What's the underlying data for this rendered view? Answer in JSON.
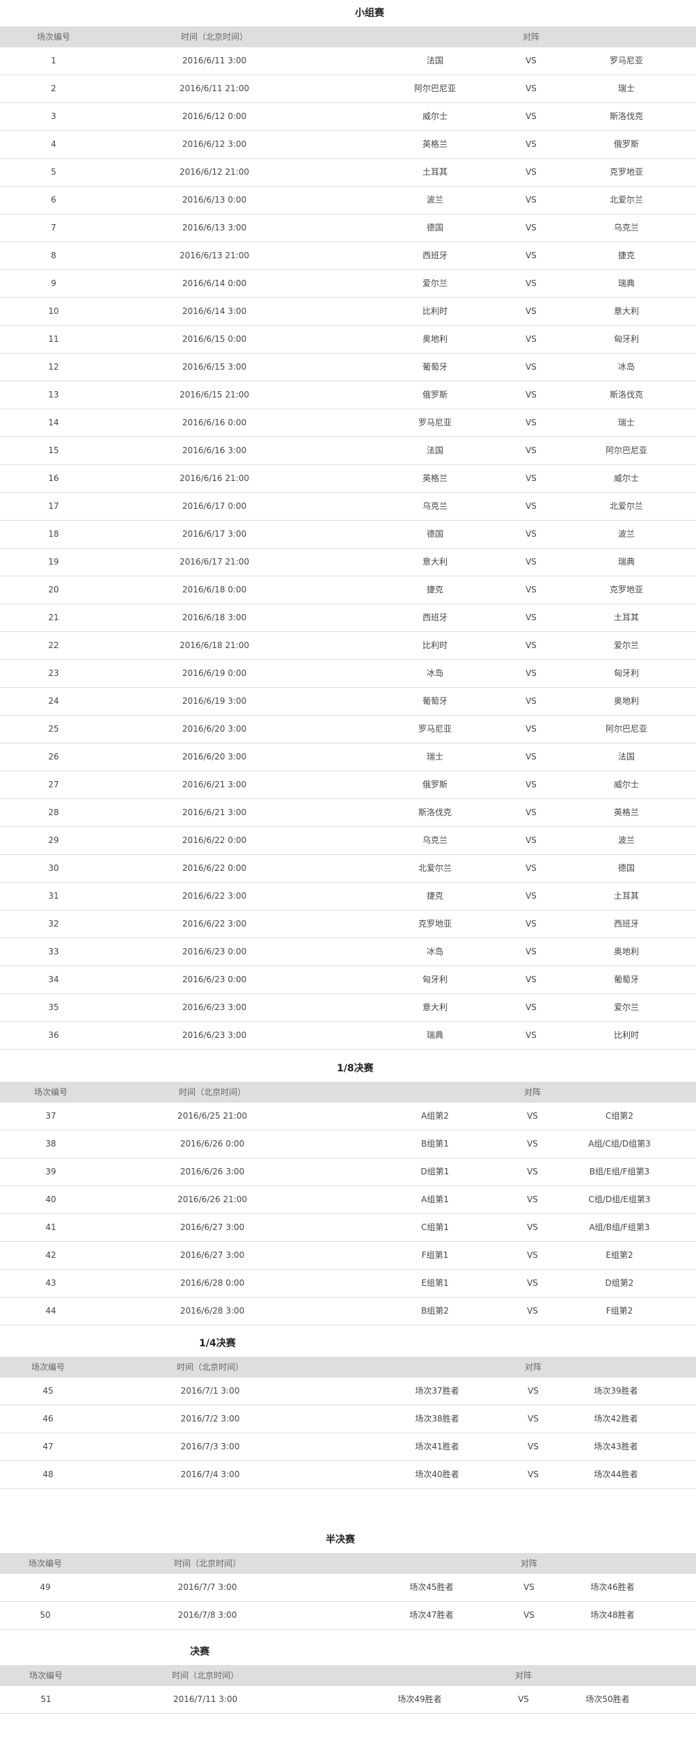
{
  "headers": {
    "num": "场次编号",
    "time": "时间（北京时间）",
    "match": "对阵",
    "vs": "VS"
  },
  "sections": [
    {
      "key": "group",
      "title": "小组赛",
      "rows": [
        [
          "1",
          "2016/6/11 3:00",
          "法国",
          "罗马尼亚"
        ],
        [
          "2",
          "2016/6/11 21:00",
          "阿尔巴尼亚",
          "瑞士"
        ],
        [
          "3",
          "2016/6/12 0:00",
          "威尔士",
          "斯洛伐克"
        ],
        [
          "4",
          "2016/6/12 3:00",
          "英格兰",
          "俄罗斯"
        ],
        [
          "5",
          "2016/6/12 21:00",
          "土耳其",
          "克罗地亚"
        ],
        [
          "6",
          "2016/6/13 0:00",
          "波兰",
          "北爱尔兰"
        ],
        [
          "7",
          "2016/6/13 3:00",
          "德国",
          "乌克兰"
        ],
        [
          "8",
          "2016/6/13 21:00",
          "西班牙",
          "捷克"
        ],
        [
          "9",
          "2016/6/14 0:00",
          "爱尔兰",
          "瑞典"
        ],
        [
          "10",
          "2016/6/14 3:00",
          "比利时",
          "意大利"
        ],
        [
          "11",
          "2016/6/15 0:00",
          "奥地利",
          "匈牙利"
        ],
        [
          "12",
          "2016/6/15 3:00",
          "葡萄牙",
          "冰岛"
        ],
        [
          "13",
          "2016/6/15 21:00",
          "俄罗斯",
          "斯洛伐克"
        ],
        [
          "14",
          "2016/6/16 0:00",
          "罗马尼亚",
          "瑞士"
        ],
        [
          "15",
          "2016/6/16 3:00",
          "法国",
          "阿尔巴尼亚"
        ],
        [
          "16",
          "2016/6/16 21:00",
          "英格兰",
          "威尔士"
        ],
        [
          "17",
          "2016/6/17 0:00",
          "乌克兰",
          "北爱尔兰"
        ],
        [
          "18",
          "2016/6/17 3:00",
          "德国",
          "波兰"
        ],
        [
          "19",
          "2016/6/17 21:00",
          "意大利",
          "瑞典"
        ],
        [
          "20",
          "2016/6/18 0:00",
          "捷克",
          "克罗地亚"
        ],
        [
          "21",
          "2016/6/18 3:00",
          "西班牙",
          "土耳其"
        ],
        [
          "22",
          "2016/6/18 21:00",
          "比利时",
          "爱尔兰"
        ],
        [
          "23",
          "2016/6/19 0:00",
          "冰岛",
          "匈牙利"
        ],
        [
          "24",
          "2016/6/19 3:00",
          "葡萄牙",
          "奥地利"
        ],
        [
          "25",
          "2016/6/20 3:00",
          "罗马尼亚",
          "阿尔巴尼亚"
        ],
        [
          "26",
          "2016/6/20 3:00",
          "瑞士",
          "法国"
        ],
        [
          "27",
          "2016/6/21 3:00",
          "俄罗斯",
          "威尔士"
        ],
        [
          "28",
          "2016/6/21 3:00",
          "斯洛伐克",
          "英格兰"
        ],
        [
          "29",
          "2016/6/22 0:00",
          "乌克兰",
          "波兰"
        ],
        [
          "30",
          "2016/6/22 0:00",
          "北爱尔兰",
          "德国"
        ],
        [
          "31",
          "2016/6/22 3:00",
          "捷克",
          "土耳其"
        ],
        [
          "32",
          "2016/6/22 3:00",
          "克罗地亚",
          "西班牙"
        ],
        [
          "33",
          "2016/6/23 0:00",
          "冰岛",
          "奥地利"
        ],
        [
          "34",
          "2016/6/23 0:00",
          "匈牙利",
          "葡萄牙"
        ],
        [
          "35",
          "2016/6/23 3:00",
          "意大利",
          "爱尔兰"
        ],
        [
          "36",
          "2016/6/23 3:00",
          "瑞典",
          "比利时"
        ]
      ]
    },
    {
      "key": "r16",
      "title": "1/8决赛",
      "rows": [
        [
          "37",
          "2016/6/25 21:00",
          "A组第2",
          "C组第2"
        ],
        [
          "38",
          "2016/6/26 0:00",
          "B组第1",
          "A组/C组/D组第3"
        ],
        [
          "39",
          "2016/6/26 3:00",
          "D组第1",
          "B组/E组/F组第3"
        ],
        [
          "40",
          "2016/6/26 21:00",
          "A组第1",
          "C组/D组/E组第3"
        ],
        [
          "41",
          "2016/6/27 3:00",
          "C组第1",
          "A组/B组/F组第3"
        ],
        [
          "42",
          "2016/6/27 3:00",
          "F组第1",
          "E组第2"
        ],
        [
          "43",
          "2016/6/28 0:00",
          "E组第1",
          "D组第2"
        ],
        [
          "44",
          "2016/6/28 3:00",
          "B组第2",
          "F组第2"
        ]
      ]
    },
    {
      "key": "qf",
      "title": "1/4决赛",
      "rows": [
        [
          "45",
          "2016/7/1 3:00",
          "场次37胜者",
          "场次39胜者"
        ],
        [
          "46",
          "2016/7/2 3:00",
          "场次38胜者",
          "场次42胜者"
        ],
        [
          "47",
          "2016/7/3 3:00",
          "场次41胜者",
          "场次43胜者"
        ],
        [
          "48",
          "2016/7/4 3:00",
          "场次40胜者",
          "场次44胜者"
        ]
      ]
    },
    {
      "key": "sf",
      "title": "半决赛",
      "rows": [
        [
          "49",
          "2016/7/7 3:00",
          "场次45胜者",
          "场次46胜者"
        ],
        [
          "50",
          "2016/7/8 3:00",
          "场次47胜者",
          "场次48胜者"
        ]
      ]
    },
    {
      "key": "final",
      "title": "决赛",
      "rows": [
        [
          "51",
          "2016/7/11 3:00",
          "场次49胜者",
          "场次50胜者"
        ]
      ]
    }
  ]
}
